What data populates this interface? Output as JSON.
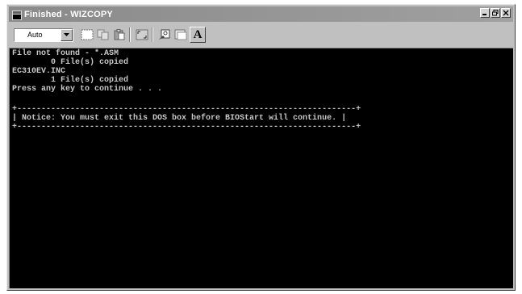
{
  "window": {
    "title": "Finished - WIZCOPY"
  },
  "toolbar": {
    "font_select_value": "Auto",
    "font_button_label": "A",
    "icons": [
      "dropdown-arrow-icon",
      "mark-icon",
      "copy-icon",
      "paste-icon",
      "fullscreen-icon",
      "properties-icon",
      "background-icon",
      "font-icon"
    ]
  },
  "console": {
    "lines": [
      "File not found - *.ASM",
      "        0 File(s) copied",
      "EC310EV.INC",
      "        1 File(s) copied",
      "Press any key to continue . . ."
    ],
    "notice_border": "+----------------------------------------------------------------------+",
    "notice_text": "| Notice: You must exit this DOS box before BIOStart will continue. |"
  },
  "colors": {
    "console_bg": "#000000",
    "console_text": "#c8c8c8",
    "titlebar": "#8a8a8a"
  }
}
